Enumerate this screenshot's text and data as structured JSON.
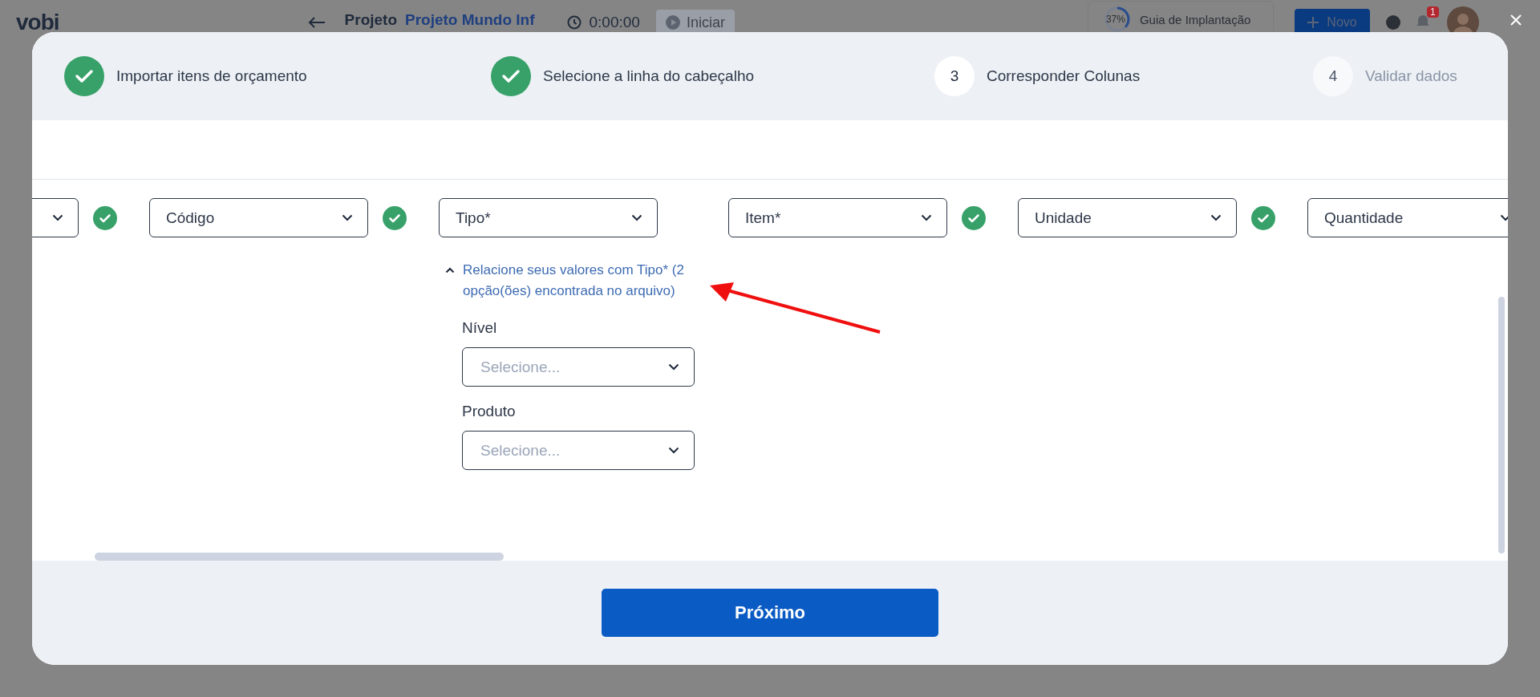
{
  "background": {
    "logo": "vobi",
    "breadcrumb_prefix": "Projeto",
    "project_link": "Projeto Mundo Inf",
    "timer": "0:00:00",
    "start_button": "Iniciar",
    "guide": {
      "percent": "37%",
      "label": "Guia de Implantação",
      "level": 0.37
    },
    "new_button": "Novo",
    "notifications_badge": "1"
  },
  "steps": [
    {
      "label": "Importar itens de orçamento",
      "kind": "done"
    },
    {
      "label": "Selecione a linha do cabeçalho",
      "kind": "done"
    },
    {
      "number": "3",
      "label": "Corresponder Colunas",
      "kind": "numbered",
      "disabled": false
    },
    {
      "number": "4",
      "label": "Validar dados",
      "kind": "numbered",
      "disabled": true
    }
  ],
  "columns": [
    {},
    {
      "value": "Código",
      "matched": true
    },
    {
      "value": "Tipo*",
      "matched": true,
      "mapping": {
        "expanded": true,
        "title": "Relacione seus valores com Tipo* (2 opção(ões) encontrada no arquivo)",
        "fields": [
          {
            "label": "Nível",
            "placeholder": "Selecione..."
          },
          {
            "label": "Produto",
            "placeholder": "Selecione..."
          }
        ]
      }
    },
    {
      "value": "Item*",
      "matched": false
    },
    {
      "value": "Unidade",
      "matched": true
    },
    {
      "value": "Quantidade",
      "matched": true
    }
  ],
  "next_button": "Próximo"
}
